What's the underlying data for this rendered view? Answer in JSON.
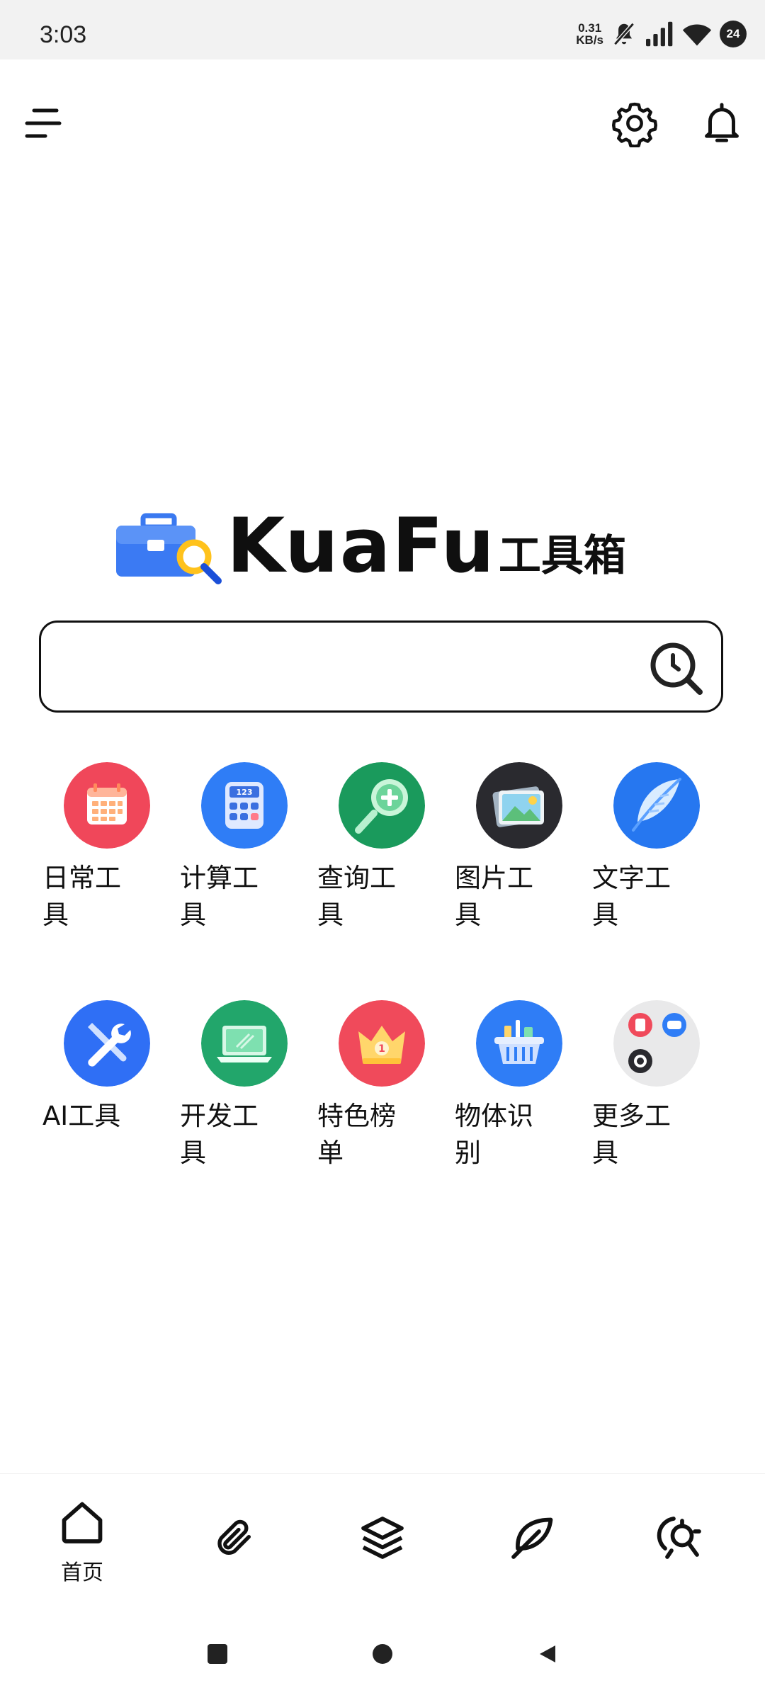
{
  "status_bar": {
    "time": "3:03",
    "net_speed_value": "0.31",
    "net_speed_unit": "KB/s",
    "battery": "24"
  },
  "search": {
    "placeholder": "",
    "value": ""
  },
  "logo": {
    "brand": "KuaFu",
    "suffix": "工具箱"
  },
  "tools": [
    {
      "label": "日常工具",
      "icon": "calendar-icon"
    },
    {
      "label": "计算工具",
      "icon": "calculator-icon"
    },
    {
      "label": "查询工具",
      "icon": "magnifier-plus-icon"
    },
    {
      "label": "图片工具",
      "icon": "photo-icon"
    },
    {
      "label": "文字工具",
      "icon": "feather-icon"
    },
    {
      "label": "AI工具",
      "icon": "wrench-screwdriver-icon"
    },
    {
      "label": "开发工具",
      "icon": "laptop-icon"
    },
    {
      "label": "特色榜单",
      "icon": "crown-icon"
    },
    {
      "label": "物体识别",
      "icon": "basket-icon"
    },
    {
      "label": "更多工具",
      "icon": "more-apps-icon"
    }
  ],
  "bottom_nav": {
    "home_label": "首页",
    "items": [
      "home-icon",
      "paperclip-icon",
      "layers-icon",
      "leaf-icon",
      "tools-icon"
    ]
  },
  "colors": {
    "daily": "#f0475a",
    "calc": "#2f7df6",
    "query": "#1a9a5c",
    "photo": "#2a2a2f",
    "text": "#2677f0",
    "ai": "#2f6ff5",
    "dev": "#22a66b",
    "rank": "#f04a5b",
    "object": "#2f7df6",
    "more": "#e9e9ea"
  }
}
